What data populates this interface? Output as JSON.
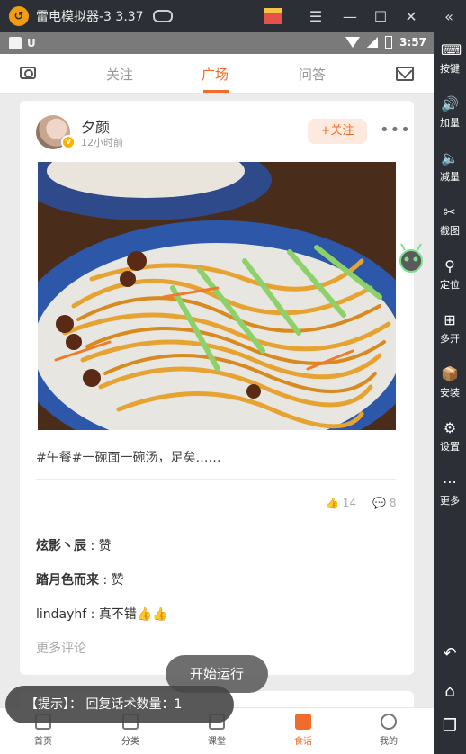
{
  "emulator": {
    "title": "雷电模拟器-3 3.37",
    "sidebar": [
      {
        "label": "按键",
        "icon": "keyboard-icon"
      },
      {
        "label": "加量",
        "icon": "volume-up-icon"
      },
      {
        "label": "减量",
        "icon": "volume-down-icon"
      },
      {
        "label": "截图",
        "icon": "scissors-icon"
      },
      {
        "label": "定位",
        "icon": "location-icon"
      },
      {
        "label": "多开",
        "icon": "multi-instance-icon"
      },
      {
        "label": "安装",
        "icon": "apk-icon"
      },
      {
        "label": "设置",
        "icon": "gear-icon"
      },
      {
        "label": "更多",
        "icon": "more-dots-icon"
      }
    ]
  },
  "statusbar": {
    "time": "3:57"
  },
  "header": {
    "tabs": [
      "关注",
      "广场",
      "问答"
    ],
    "active_tab": "广场"
  },
  "post": {
    "user": "夕颜",
    "time": "12小时前",
    "badge": "V",
    "follow_label": "+关注",
    "more_label": "•••",
    "text": "#午餐#一碗面一碗汤，足矣……",
    "likes": "14",
    "comments_count": "8",
    "comments": [
      {
        "user": "炫影丶辰",
        "text": "赞"
      },
      {
        "user": "踏月色而来",
        "text": "赞"
      },
      {
        "user": "lindayhf",
        "text": "真不错👍👍"
      }
    ],
    "more_comments": "更多评论"
  },
  "bottom_nav": [
    {
      "label": "首页"
    },
    {
      "label": "分类"
    },
    {
      "label": "课堂"
    },
    {
      "label": "食话"
    },
    {
      "label": "我的"
    }
  ],
  "overlay": {
    "run_button": "开始运行",
    "toast": "【提示】： 回复话术数量：1"
  },
  "colors": {
    "accent": "#f06c2a",
    "emulator_chrome": "#2c2f36"
  }
}
